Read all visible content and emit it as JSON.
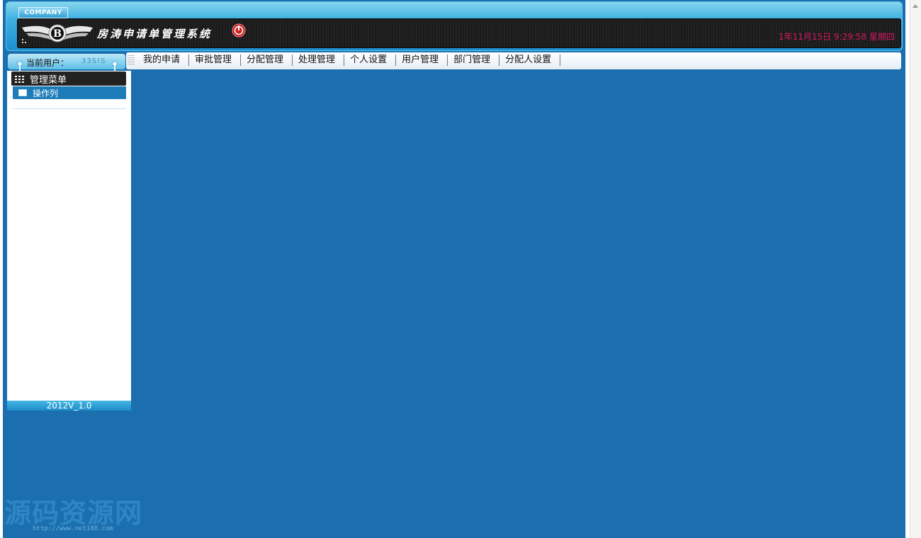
{
  "header": {
    "company_tag": "COMPANY",
    "system_title": "房涛申请单管理系统",
    "datetime": "1年11月15日 9:29:58 星期四"
  },
  "user_bar": {
    "label": "当前用户：",
    "username": "33S!S"
  },
  "menu": {
    "header": "管理菜单",
    "items": [
      {
        "label": "操作列",
        "icon": "book-icon"
      }
    ]
  },
  "version": "2012V_1.0",
  "nav": {
    "tabs": [
      {
        "label": "我的申请"
      },
      {
        "label": "审批管理"
      },
      {
        "label": "分配管理"
      },
      {
        "label": "处理管理"
      },
      {
        "label": "个人设置"
      },
      {
        "label": "用户管理"
      },
      {
        "label": "部门管理"
      },
      {
        "label": "分配人设置"
      }
    ]
  },
  "watermark": {
    "title": "源码资源网",
    "url": "http://www.net188.com"
  },
  "colors": {
    "content_bg": "#1b6fae",
    "datetime": "#d6185e",
    "header_accent": "#3fb1e0"
  },
  "icons": [
    "logo-emblem",
    "power-icon",
    "grid-icon",
    "menu-list-icon",
    "book-icon",
    "scroll-up-arrow"
  ]
}
